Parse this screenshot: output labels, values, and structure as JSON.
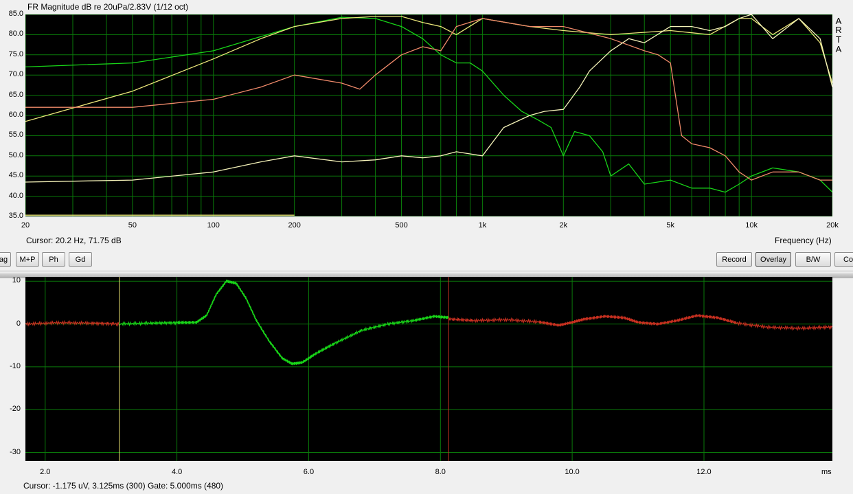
{
  "fr_panel": {
    "title": "FR Magnitude dB re 20uPa/2.83V (1/12 oct)",
    "cursor": "Cursor: 20.2 Hz, 71.75 dB",
    "x_axis_label": "Frequency (Hz)",
    "arta_letters": [
      "A",
      "R",
      "T",
      "A"
    ]
  },
  "toolbar": {
    "left_buttons": [
      "ag",
      "M+P",
      "Ph",
      "Gd"
    ],
    "right_buttons": [
      "Record",
      "Overlay",
      "B/W",
      "Co"
    ],
    "active_button": "Overlay"
  },
  "impulse_panel": {
    "cursor": "Cursor: -1.175 uV, 3.125ms (300)  Gate: 5.000ms (480)",
    "x_unit": "ms"
  },
  "colors": {
    "plot_bg": "#000000",
    "grid": "#0a7a0a",
    "green": "#18d418",
    "yellow": "#ece77a",
    "salmon": "#f08a6a",
    "white_yellow": "#f4f2b8",
    "red": "#c83020",
    "marker_yellow": "#e8e070",
    "marker_red": "#c03020"
  },
  "chart_data": [
    {
      "type": "line",
      "title": "FR Magnitude dB re 20uPa/2.83V (1/12 oct)",
      "xlabel": "Frequency (Hz)",
      "ylabel": "",
      "x_scale": "log",
      "xlim": [
        20,
        20000
      ],
      "ylim": [
        35,
        85
      ],
      "x_ticks": [
        20,
        50,
        100,
        200,
        500,
        1000,
        2000,
        5000,
        10000,
        20000
      ],
      "x_tick_labels": [
        "20",
        "50",
        "100",
        "200",
        "500",
        "1k",
        "2k",
        "5k",
        "10k",
        "20k"
      ],
      "y_ticks": [
        35,
        40,
        45,
        50,
        55,
        60,
        65,
        70,
        75,
        80,
        85
      ],
      "y_tick_labels": [
        "35.0",
        "40.0",
        "45.0",
        "50.0",
        "55.0",
        "60.0",
        "65.0",
        "70.0",
        "75.0",
        "80.0",
        "85.0"
      ],
      "grid": true,
      "series": [
        {
          "color": "green",
          "x": [
            20,
            50,
            100,
            150,
            200,
            300,
            400,
            500,
            600,
            700,
            800,
            900,
            1000,
            1200,
            1400,
            1600,
            1800,
            2000,
            2200,
            2500,
            2800,
            3000,
            3500,
            4000,
            5000,
            6000,
            7000,
            8000,
            9000,
            10000,
            12000,
            15000,
            18000,
            20000
          ],
          "y": [
            72,
            73,
            76,
            79.5,
            82,
            84.3,
            84,
            82,
            79,
            75,
            73,
            73,
            71,
            65,
            61,
            59,
            57,
            50,
            56,
            55,
            51,
            45,
            48,
            43,
            44,
            42,
            42,
            41,
            43,
            45,
            47,
            46,
            44,
            41
          ]
        },
        {
          "color": "yellow",
          "x": [
            20,
            50,
            100,
            150,
            200,
            300,
            400,
            500,
            600,
            700,
            800,
            1000,
            1500,
            2000,
            3000,
            5000,
            7000,
            9000,
            10000,
            12000,
            15000,
            18000,
            20000
          ],
          "y": [
            58.5,
            66,
            74,
            79,
            82,
            84,
            84.5,
            84.5,
            83,
            82,
            80,
            84,
            82,
            81,
            80,
            81,
            80,
            84,
            84,
            80,
            84,
            78,
            68
          ]
        },
        {
          "color": "salmon",
          "x": [
            20,
            50,
            100,
            150,
            200,
            300,
            350,
            400,
            500,
            600,
            700,
            800,
            1000,
            1500,
            2000,
            3000,
            4000,
            4500,
            5000,
            5500,
            6000,
            7000,
            8000,
            9000,
            10000,
            12000,
            15000,
            18000,
            20000
          ],
          "y": [
            62,
            62,
            64,
            67,
            70,
            68,
            66.5,
            70,
            75,
            77,
            76,
            82,
            84,
            82,
            82,
            79,
            76,
            75,
            73,
            55,
            53,
            52,
            50,
            46,
            44,
            46,
            46,
            44,
            44
          ]
        },
        {
          "color": "white_yellow",
          "x": [
            20,
            50,
            100,
            150,
            200,
            300,
            400,
            500,
            600,
            700,
            800,
            1000,
            1200,
            1500,
            1700,
            2000,
            2300,
            2500,
            3000,
            3500,
            4000,
            5000,
            6000,
            7000,
            8000,
            9000,
            10000,
            12000,
            15000,
            18000,
            20000
          ],
          "y": [
            43.5,
            44,
            46,
            48.5,
            50,
            48.5,
            49,
            50,
            49.5,
            50,
            51,
            50,
            57,
            60,
            61,
            61.5,
            67,
            71,
            76,
            79,
            78,
            82,
            82,
            81,
            82,
            84,
            85,
            79,
            84,
            79,
            67
          ]
        },
        {
          "color": "yellow",
          "x": [
            20,
            200
          ],
          "y": [
            35.3,
            35.3
          ]
        }
      ]
    },
    {
      "type": "line",
      "title": "",
      "xlabel": "ms",
      "ylabel": "",
      "xlim": [
        1.7,
        13.95
      ],
      "ylim": [
        -32,
        11
      ],
      "x_ticks": [
        2.0,
        4.0,
        6.0,
        8.0,
        10.0,
        12.0
      ],
      "x_tick_labels": [
        "2.0",
        "4.0",
        "6.0",
        "8.0",
        "10.0",
        "12.0"
      ],
      "y_ticks": [
        10,
        0,
        -10,
        -20,
        -30
      ],
      "y_tick_labels": [
        "10",
        "0",
        "-10",
        "-20",
        "-30"
      ],
      "grid": true,
      "markers": [
        {
          "x": 3.125,
          "color": "marker_yellow"
        },
        {
          "x": 8.125,
          "color": "marker_red"
        }
      ],
      "series": [
        {
          "color": "red",
          "x": [
            1.7,
            2.2,
            2.7,
            3.125
          ],
          "y": [
            0,
            0.3,
            0.2,
            0
          ]
        },
        {
          "color": "green",
          "x": [
            3.125,
            3.6,
            4.0,
            4.3,
            4.45,
            4.6,
            4.75,
            4.9,
            5.05,
            5.2,
            5.4,
            5.6,
            5.75,
            5.9,
            6.1,
            6.4,
            6.8,
            7.2,
            7.6,
            7.9,
            8.125
          ],
          "y": [
            0,
            0.2,
            0.3,
            0.4,
            2,
            7,
            10,
            9.5,
            6,
            1,
            -4,
            -8,
            -9.3,
            -9,
            -7,
            -4.5,
            -1.5,
            0,
            0.8,
            1.8,
            1.5
          ]
        },
        {
          "color": "red",
          "x": [
            8.125,
            8.5,
            9.0,
            9.5,
            9.8,
            10.0,
            10.2,
            10.5,
            10.8,
            11.0,
            11.3,
            11.6,
            11.9,
            12.2,
            12.5,
            13.0,
            13.5,
            13.95
          ],
          "y": [
            1.2,
            0.8,
            1,
            0.5,
            -0.3,
            0.4,
            1.2,
            1.8,
            1.4,
            0.4,
            0,
            0.8,
            2,
            1.5,
            0.2,
            -0.8,
            -1,
            -0.7
          ]
        }
      ]
    }
  ]
}
